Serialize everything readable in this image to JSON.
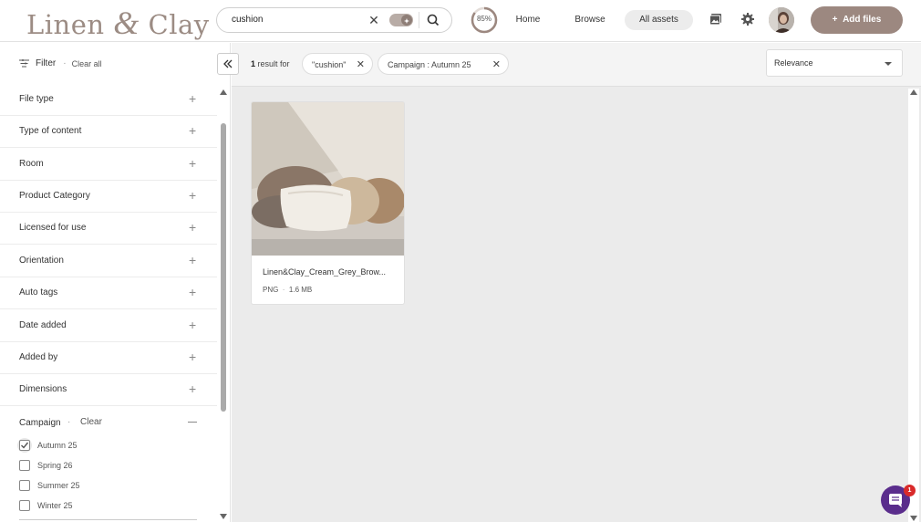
{
  "brand": {
    "logo_left": "Linen ",
    "logo_amp": "&",
    "logo_right": " Clay"
  },
  "search": {
    "value": "cushion",
    "clear_icon": "close-icon",
    "toggle": "ai-search-toggle",
    "icon": "search-icon"
  },
  "header": {
    "progress": "85%",
    "progress_fraction": 0.85,
    "nav": [
      "Home",
      "Browse",
      "All assets"
    ],
    "active_nav": "All assets",
    "icons": [
      "gallery-icon",
      "gear-icon"
    ],
    "add_files": "Add files",
    "accent": "#9c8880"
  },
  "sidebar": {
    "filter_label": "Filter",
    "clear_all": "Clear all",
    "facets": [
      "File type",
      "Type of content",
      "Room",
      "Product Category",
      "Licensed for use",
      "Orientation",
      "Auto tags",
      "Date added",
      "Added by",
      "Dimensions"
    ],
    "campaign": {
      "label": "Campaign",
      "clear": "Clear",
      "options": [
        {
          "label": "Autumn 25",
          "checked": true
        },
        {
          "label": "Spring 26",
          "checked": false
        },
        {
          "label": "Summer 25",
          "checked": false
        },
        {
          "label": "Winter 25",
          "checked": false
        }
      ]
    }
  },
  "results": {
    "count": "1",
    "suffix": "result for",
    "chips": [
      "\"cushion\"",
      "Campaign :  Autumn 25"
    ],
    "sort": "Relevance"
  },
  "asset": {
    "name": "Linen&Clay_Cream_Grey_Brow...",
    "type": "PNG",
    "size": "1.6 MB"
  },
  "chat": {
    "badge": "1"
  }
}
